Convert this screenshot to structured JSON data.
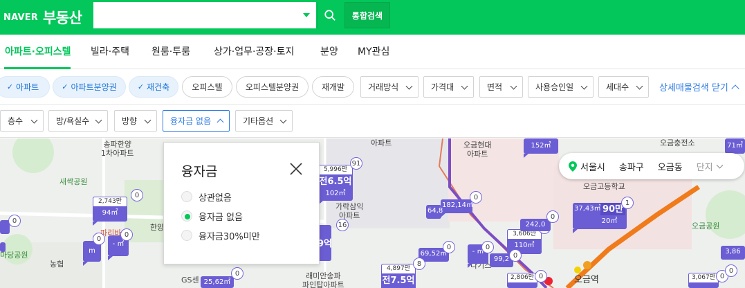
{
  "header": {
    "naver": "NAVER",
    "service": "부동산",
    "search_value": "",
    "total_search": "통합검색"
  },
  "tabs": [
    "아파트·오피스텔",
    "빌라·주택",
    "원룸·투룸",
    "상가·업무·공장·토지",
    "분양",
    "MY관심"
  ],
  "row1": {
    "chips_selected": [
      "아파트",
      "아파트분양권",
      "재건축"
    ],
    "chips_unselected": [
      "오피스텔",
      "오피스텔분양권",
      "재개발"
    ],
    "dropdowns": [
      "거래방식",
      "가격대",
      "면적",
      "사용승인일",
      "세대수"
    ],
    "close_detail": "상세매물검색 닫기"
  },
  "row2": {
    "dropdowns": [
      "층수",
      "방/욕실수",
      "방향",
      "융자금 없음",
      "기타옵션"
    ]
  },
  "popup": {
    "title": "융자금",
    "options": [
      {
        "label": "상관없음",
        "selected": false
      },
      {
        "label": "융자금 없음",
        "selected": true
      },
      {
        "label": "융자금30%미만",
        "selected": false
      }
    ]
  },
  "region": {
    "city": "서울시",
    "district": "송파구",
    "dong": "오금동",
    "complex": "단지"
  },
  "map_labels": {
    "songpa_hanyang": "송파한양\n1차아파트",
    "saessak_park": "새싹공원",
    "park2": "마당공원",
    "nonghyup": "농협",
    "paris": "파리바게",
    "hanyang": "한양",
    "ogeum_hyundai": "오금현대\n아파트",
    "ogeum_school": "오금고등학교",
    "ogeum_park": "오금공원",
    "ogeum_station": "오금역",
    "garak": "가락삼익\n아파트",
    "raemian": "래미안송파\n파인탑아파트",
    "ogeum_fire": "오금충전소",
    "apt1": "아파트",
    "gs": "GS센",
    "dagis": "다기스"
  },
  "pins": {
    "p1_top": "2,743만",
    "p1_body": "94㎡",
    "p1_cnt": "0",
    "p2_top": "5,996만",
    "p2_price": "전6.5억",
    "p2_body": "102㎡",
    "p2_cnt": "91",
    "p3_body": "182,14㎡",
    "p3_cnt": "0",
    "p4_body": "64,8",
    "p5_cnt": "16",
    "p6_top": "3,606만",
    "p6_body": "110㎡",
    "p6_cnt": "0",
    "p7_body": "242,0",
    "p7_cnt": "0",
    "p8_body": "37,43㎡",
    "p8_price": "90만",
    "p8_sub": "20㎡",
    "p8_cnt": "1",
    "p9_body": "152㎡",
    "p10_body": "69,52㎡",
    "p10_cnt": "0",
    "p11_top": "4,897만",
    "p11_price": "전7.5억",
    "p11_cnt": "8",
    "p12_top": "2,806만",
    "p12_cnt": "0",
    "p13_top": "3,067만",
    "p13_cnt": "0",
    "p14_body": "- ㎡",
    "p14_cnt": "0",
    "p15_body": "99,2",
    "p15_cnt": "0",
    "p16_body": "25,62㎡",
    "p16_cnt": "0",
    "p17_body": "- ㎡",
    "p17_cnt": "0",
    "p18_body": "m",
    "p18_cnt": "0",
    "p19_body": "71㎡",
    "p20_price": "9억",
    "p21_body": "3,86",
    "p22_cnt": "0",
    "p23_cnt": "0"
  },
  "colors": {
    "brand": "#03c75a",
    "pin": "#6b5dd3",
    "accent_blue": "#2d7be5"
  }
}
